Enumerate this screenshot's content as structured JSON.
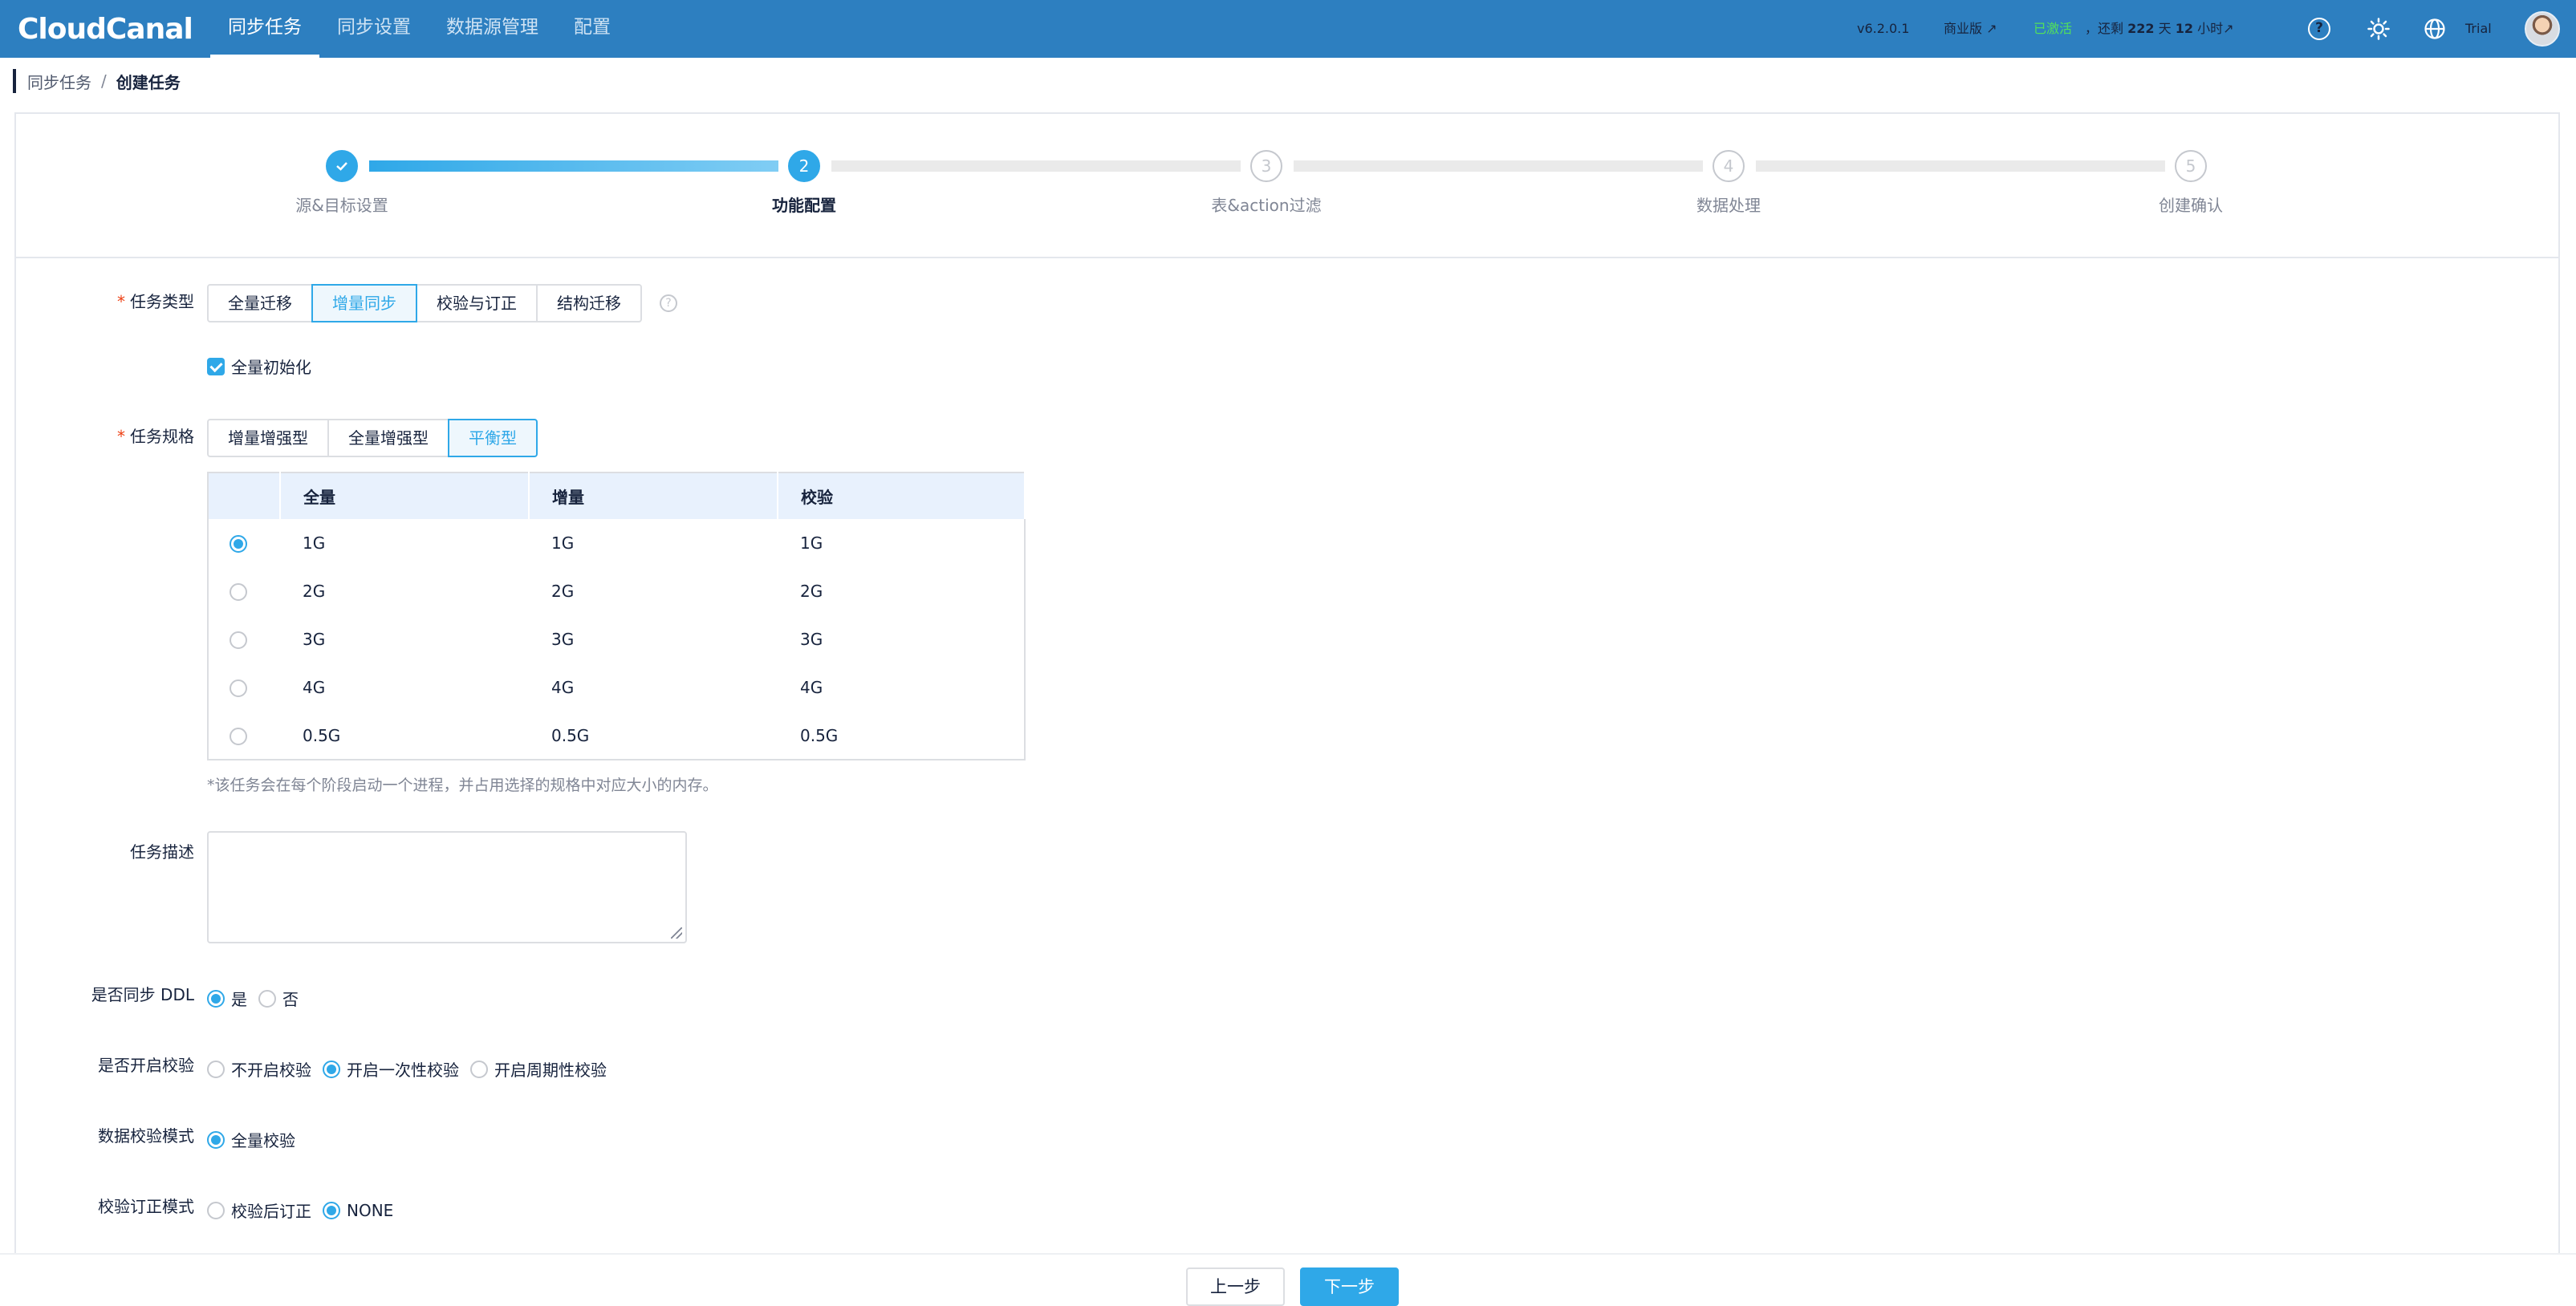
{
  "app": {
    "logo_text": "CloudCanal",
    "nav": [
      "同步任务",
      "同步设置",
      "数据源管理",
      "配置"
    ],
    "active_nav": 0,
    "version": "v6.2.0.1",
    "edition": "商业版 ↗",
    "activated": "已激活",
    "remaining_prefix": "，还剩",
    "remaining_days": "222",
    "days_unit": "天",
    "remaining_hours": "12",
    "hours_unit": "小时↗",
    "user": "Trial",
    "help_glyph": "?"
  },
  "breadcrumb": {
    "parent": "同步任务",
    "separator": "/",
    "current": "创建任务"
  },
  "steps": [
    {
      "label": "源&目标设置",
      "number": "✓",
      "status": "done"
    },
    {
      "label": "功能配置",
      "number": "2",
      "status": "current"
    },
    {
      "label": "表&action过滤",
      "number": "3",
      "status": "wait"
    },
    {
      "label": "数据处理",
      "number": "4",
      "status": "wait"
    },
    {
      "label": "创建确认",
      "number": "5",
      "status": "wait"
    }
  ],
  "form": {
    "required_mark": "*",
    "task_type": {
      "label": "任务类型",
      "options": [
        "全量迁移",
        "增量同步",
        "校验与订正",
        "结构迁移"
      ],
      "selected": "增量同步",
      "help_glyph": "?"
    },
    "full_init": {
      "label": "全量初始化",
      "checked": true
    },
    "task_spec": {
      "label": "任务规格",
      "options": [
        "增量增强型",
        "全量增强型",
        "平衡型"
      ],
      "selected": "平衡型"
    },
    "spec_table": {
      "headers": [
        "全量",
        "增量",
        "校验"
      ],
      "rows": [
        [
          "1G",
          "1G",
          "1G"
        ],
        [
          "2G",
          "2G",
          "2G"
        ],
        [
          "3G",
          "3G",
          "3G"
        ],
        [
          "4G",
          "4G",
          "4G"
        ],
        [
          "0.5G",
          "0.5G",
          "0.5G"
        ]
      ],
      "selected_row": 0
    },
    "spec_hint": "*该任务会在每个阶段启动一个进程，并占用选择的规格中对应大小的内存。",
    "description": {
      "label": "任务描述",
      "value": ""
    },
    "sync_ddl": {
      "label": "是否同步 DDL",
      "options": [
        "是",
        "否"
      ],
      "selected": "是"
    },
    "enable_check": {
      "label": "是否开启校验",
      "options": [
        "不开启校验",
        "开启一次性校验",
        "开启周期性校验"
      ],
      "selected": "开启一次性校验"
    },
    "check_mode": {
      "label": "数据校验模式",
      "options": [
        "全量校验"
      ],
      "selected": "全量校验"
    },
    "revise_mode": {
      "label": "校验订正模式",
      "options": [
        "校验后订正",
        "NONE"
      ],
      "selected": "NONE"
    }
  },
  "footer": {
    "prev_label": "上一步",
    "next_label": "下一步"
  },
  "colors": {
    "topbar": "#2d7fc0",
    "accent": "#2fa8e8",
    "activated": "#52e05c"
  }
}
